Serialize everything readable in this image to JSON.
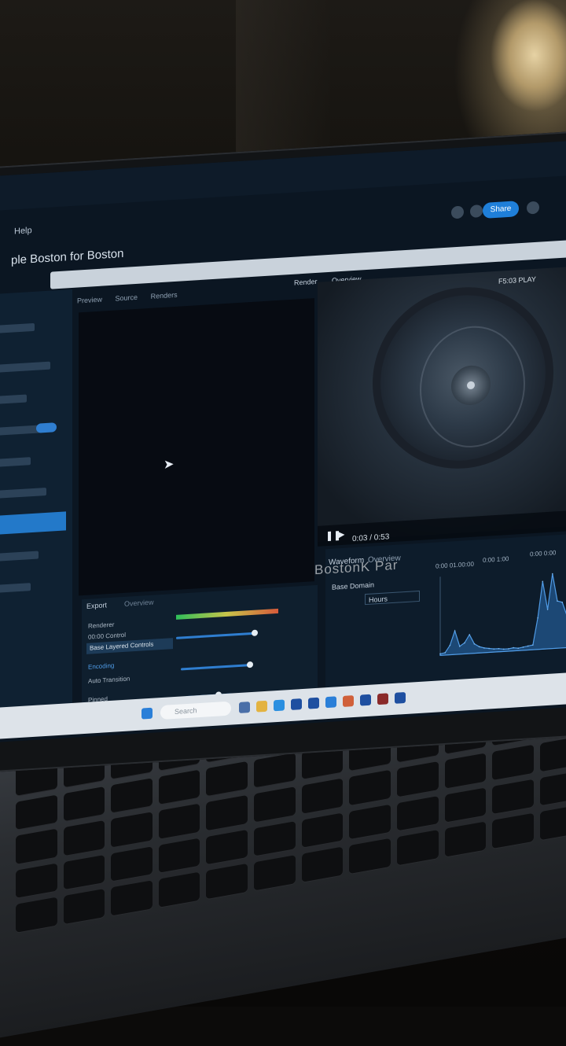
{
  "scene": {
    "brand_label": "BostonK Par",
    "background_color": "#0c0b0a",
    "lamp_color": "#e6d2a4"
  },
  "app": {
    "menu_label": "Help",
    "window_title": "ple Boston for Boston",
    "share_label": "Share",
    "accent_color": "#2379c9"
  },
  "editor": {
    "tabs": [
      "Preview",
      "Source",
      "Renders"
    ],
    "view_labels": [
      "Render",
      "Overview"
    ]
  },
  "video": {
    "badge": "F5:03 PLAY",
    "time": "0:03 / 0:53"
  },
  "analysis": {
    "tabs": [
      "Waveform",
      "Overview"
    ],
    "dropdown_label": "Base Domain",
    "dropdown_value": "Hours",
    "header_values": [
      "0:00 01.00:00",
      "0:00 1:00",
      "0:00 0:00"
    ]
  },
  "mixer": {
    "tabs": [
      "Export",
      "Overview"
    ],
    "items": [
      "Renderer",
      "00:00 Control",
      "Base Layered Controls",
      "Encoding",
      "Auto Transition",
      "Pinned"
    ]
  },
  "taskbar": {
    "search_placeholder": "Search"
  },
  "chart_data": {
    "type": "area",
    "title": "",
    "xlabel": "",
    "ylabel": "",
    "x": [
      0,
      1,
      2,
      3,
      4,
      5,
      6,
      7,
      8,
      9,
      10,
      11,
      12,
      13,
      14,
      15,
      16,
      17,
      18,
      19,
      20,
      21,
      22,
      23,
      24,
      25,
      26,
      27,
      28,
      29
    ],
    "values": [
      2,
      3,
      12,
      30,
      10,
      14,
      24,
      12,
      8,
      6,
      5,
      4,
      4,
      3,
      3,
      4,
      3,
      4,
      5,
      6,
      40,
      86,
      50,
      95,
      60,
      58,
      40,
      30,
      25,
      20
    ],
    "ylim": [
      0,
      100
    ],
    "grid": false
  }
}
